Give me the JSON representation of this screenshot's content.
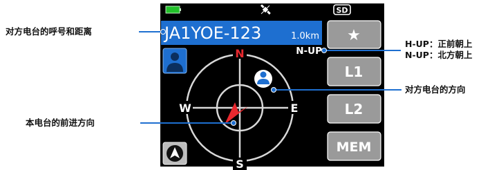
{
  "screen": {
    "status_bar": {
      "battery_icon": "battery-icon",
      "gps_icon": "satellite-icon",
      "sd_label": "SD"
    },
    "callsign": "JA1YOE-123",
    "distance": "1.0km",
    "mode_label": "N-UP",
    "compass": {
      "north": "N",
      "south": "S",
      "east": "E",
      "west": "W"
    },
    "buttons": {
      "star": "★",
      "l1": "L1",
      "l2": "L2",
      "mem": "MEM"
    },
    "icons": {
      "station_icon": "person-icon",
      "nav_icon": "navigation-icon",
      "target_icon": "person-icon",
      "heading_icon": "arrow-icon"
    }
  },
  "callouts": {
    "callsign_distance": "对方电台的呼号和距离",
    "h_up": "H-UP：正前朝上",
    "n_up": "N-UP：北方朝上",
    "station_direction": "对方电台的方向",
    "own_heading": "本电台的前进方向"
  },
  "colors": {
    "screen_bg": "#000000",
    "callsign_bar": "#1e6fd0",
    "accent_blue": "#1e6fd0",
    "north_red": "#e8282e",
    "button_gray": "#9a9a9a",
    "battery_green": "#22c22a"
  }
}
